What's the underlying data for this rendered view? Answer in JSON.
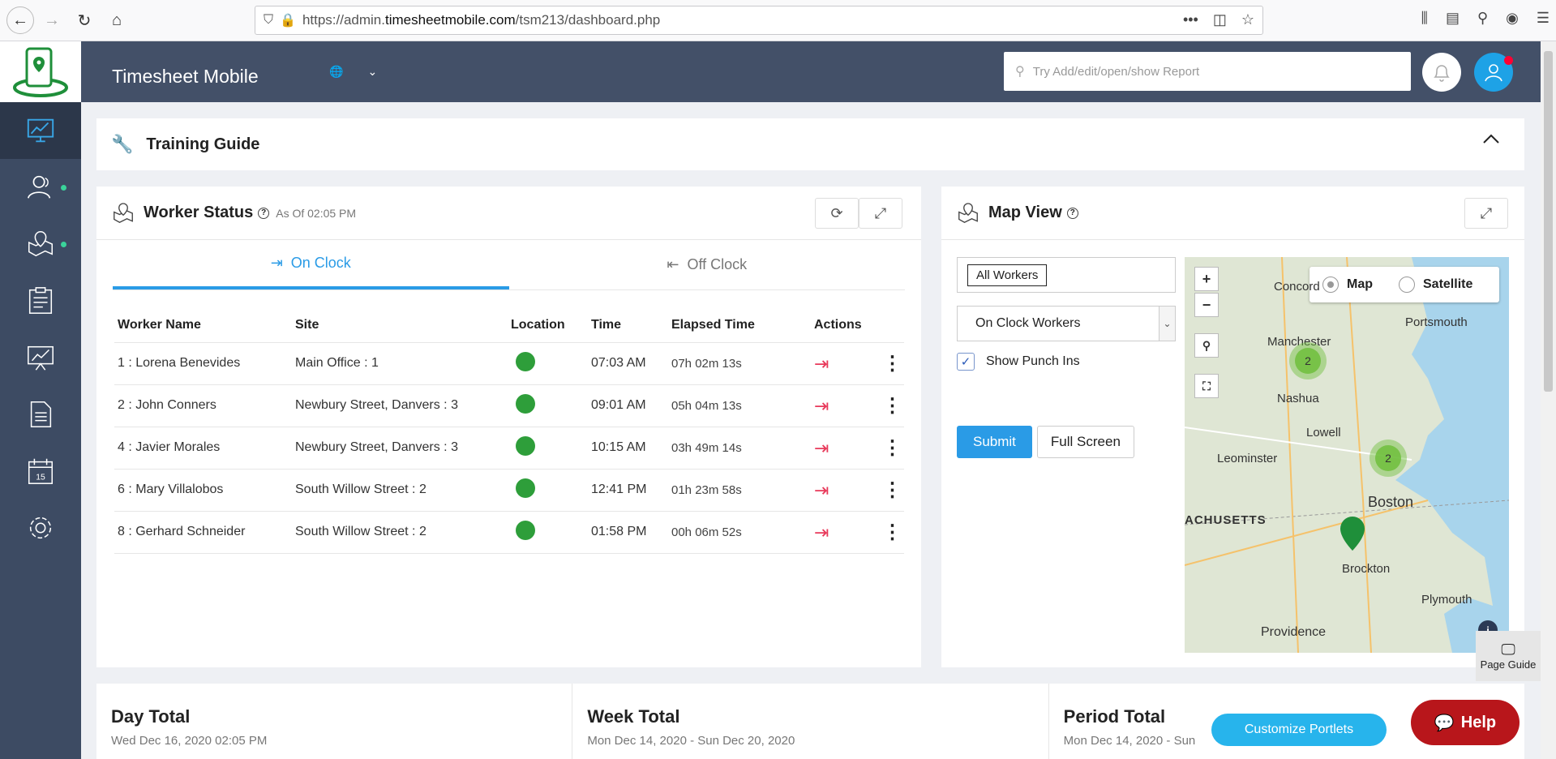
{
  "browser": {
    "url_prefix": "https://admin.",
    "url_domain": "timesheetmobile.com",
    "url_path": "/tsm213/dashboard.php"
  },
  "header": {
    "brand": "Timesheet Mobile",
    "search_placeholder": "Try Add/edit/open/show Report"
  },
  "training": {
    "title": "Training Guide"
  },
  "worker_status": {
    "title": "Worker Status",
    "as_of": "As Of 02:05 PM",
    "tabs": {
      "on_clock": "On Clock",
      "off_clock": "Off Clock"
    },
    "columns": {
      "name": "Worker Name",
      "site": "Site",
      "location": "Location",
      "time": "Time",
      "elapsed": "Elapsed Time",
      "actions": "Actions"
    },
    "rows": [
      {
        "name": "1 : Lorena Benevides",
        "site": "Main Office : 1",
        "time": "07:03 AM",
        "elapsed": "07h 02m 13s"
      },
      {
        "name": "2 : John Conners",
        "site": "Newbury Street, Danvers : 3",
        "time": "09:01 AM",
        "elapsed": "05h 04m 13s"
      },
      {
        "name": "4 : Javier Morales",
        "site": "Newbury Street, Danvers : 3",
        "time": "10:15 AM",
        "elapsed": "03h 49m 14s"
      },
      {
        "name": "6 : Mary Villalobos",
        "site": "South Willow Street : 2",
        "time": "12:41 PM",
        "elapsed": "01h 23m 58s"
      },
      {
        "name": "8 : Gerhard Schneider",
        "site": "South Willow Street : 2",
        "time": "01:58 PM",
        "elapsed": "00h 06m 52s"
      }
    ]
  },
  "map_view": {
    "title": "Map View",
    "worker_chip": "All Workers",
    "select_value": "On Clock Workers",
    "show_punch_ins": "Show Punch Ins",
    "submit": "Submit",
    "full_screen": "Full Screen",
    "map_type": {
      "map": "Map",
      "satellite": "Satellite"
    },
    "zoom_in": "+",
    "zoom_out": "−",
    "cities": {
      "concord": "Concord",
      "portsmouth": "Portsmouth",
      "manchester": "Manchester",
      "nashua": "Nashua",
      "lowell": "Lowell",
      "leominster": "Leominster",
      "boston": "Boston",
      "achusetts": "ACHUSETTS",
      "brockton": "Brockton",
      "plymouth": "Plymouth",
      "providence": "Providence"
    },
    "clusters": {
      "a": "2",
      "b": "2"
    },
    "page_guide": "Page Guide"
  },
  "totals": {
    "day": {
      "title": "Day Total",
      "date": "Wed Dec 16, 2020 02:05 PM"
    },
    "week": {
      "title": "Week Total",
      "date": "Mon Dec 14, 2020 - Sun Dec 20, 2020"
    },
    "period": {
      "title": "Period Total",
      "date": "Mon Dec 14, 2020 - Sun"
    }
  },
  "buttons": {
    "customize": "Customize Portlets",
    "help": "Help"
  }
}
